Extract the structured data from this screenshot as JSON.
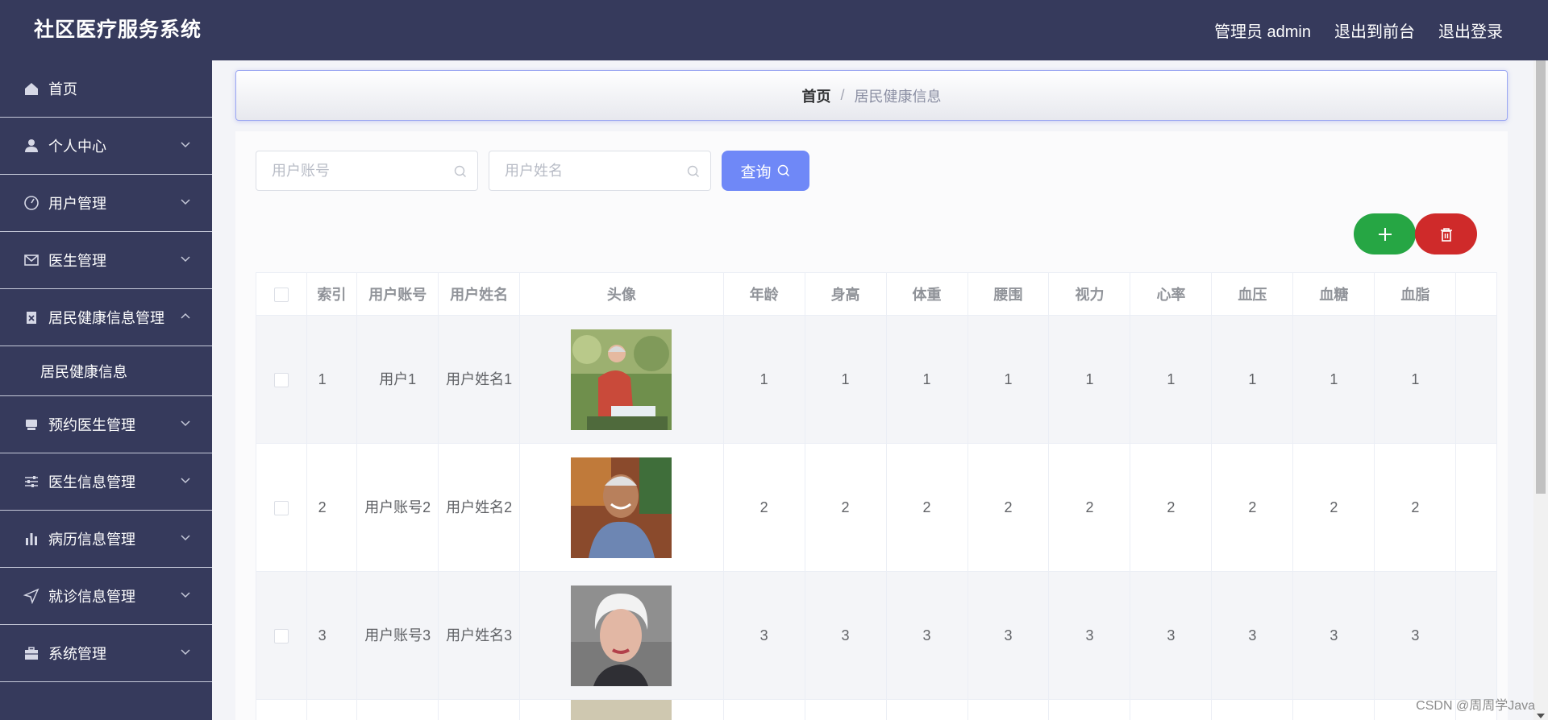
{
  "header": {
    "app_title": "社区医疗服务系统",
    "admin_label": "管理员 admin",
    "to_front_label": "退出到前台",
    "logout_label": "退出登录"
  },
  "sidebar": {
    "items": [
      {
        "label": "首页",
        "icon": "home-icon",
        "has_arrow": false
      },
      {
        "label": "个人中心",
        "icon": "user-icon",
        "has_arrow": true
      },
      {
        "label": "用户管理",
        "icon": "gauge-icon",
        "has_arrow": true
      },
      {
        "label": "医生管理",
        "icon": "envelope-icon",
        "has_arrow": true
      },
      {
        "label": "居民健康信息管理",
        "icon": "clipboard-icon",
        "has_arrow": true,
        "expanded": true
      },
      {
        "label": "预约医生管理",
        "icon": "tray-icon",
        "has_arrow": true
      },
      {
        "label": "医生信息管理",
        "icon": "sliders-icon",
        "has_arrow": true
      },
      {
        "label": "病历信息管理",
        "icon": "bar-chart-icon",
        "has_arrow": true
      },
      {
        "label": "就诊信息管理",
        "icon": "send-icon",
        "has_arrow": true
      },
      {
        "label": "系统管理",
        "icon": "briefcase-icon",
        "has_arrow": true
      }
    ],
    "submenu_label": "居民健康信息"
  },
  "breadcrumb": {
    "home": "首页",
    "separator": "/",
    "current": "居民健康信息"
  },
  "search": {
    "account_placeholder": "用户账号",
    "name_placeholder": "用户姓名",
    "query_label": "查询"
  },
  "table": {
    "headers": [
      "索引",
      "用户账号",
      "用户姓名",
      "头像",
      "年龄",
      "身高",
      "体重",
      "腰围",
      "视力",
      "心率",
      "血压",
      "血糖",
      "血脂"
    ],
    "rows": [
      {
        "index": "1",
        "account": "用户1",
        "name": "用户姓名1",
        "age": "1",
        "height": "1",
        "weight": "1",
        "waist": "1",
        "vision": "1",
        "heart_rate": "1",
        "blood_pressure": "1",
        "blood_sugar": "1",
        "blood_lipid": "1"
      },
      {
        "index": "2",
        "account": "用户账号2",
        "name": "用户姓名2",
        "age": "2",
        "height": "2",
        "weight": "2",
        "waist": "2",
        "vision": "2",
        "heart_rate": "2",
        "blood_pressure": "2",
        "blood_sugar": "2",
        "blood_lipid": "2"
      },
      {
        "index": "3",
        "account": "用户账号3",
        "name": "用户姓名3",
        "age": "3",
        "height": "3",
        "weight": "3",
        "waist": "3",
        "vision": "3",
        "heart_rate": "3",
        "blood_pressure": "3",
        "blood_sugar": "3",
        "blood_lipid": "3"
      }
    ]
  },
  "watermark": "CSDN @周周学Java",
  "colors": {
    "sidebar_bg": "#363a5c",
    "query_button": "#6f88f7",
    "add_button": "#26a644",
    "delete_button": "#cf2a2a"
  }
}
